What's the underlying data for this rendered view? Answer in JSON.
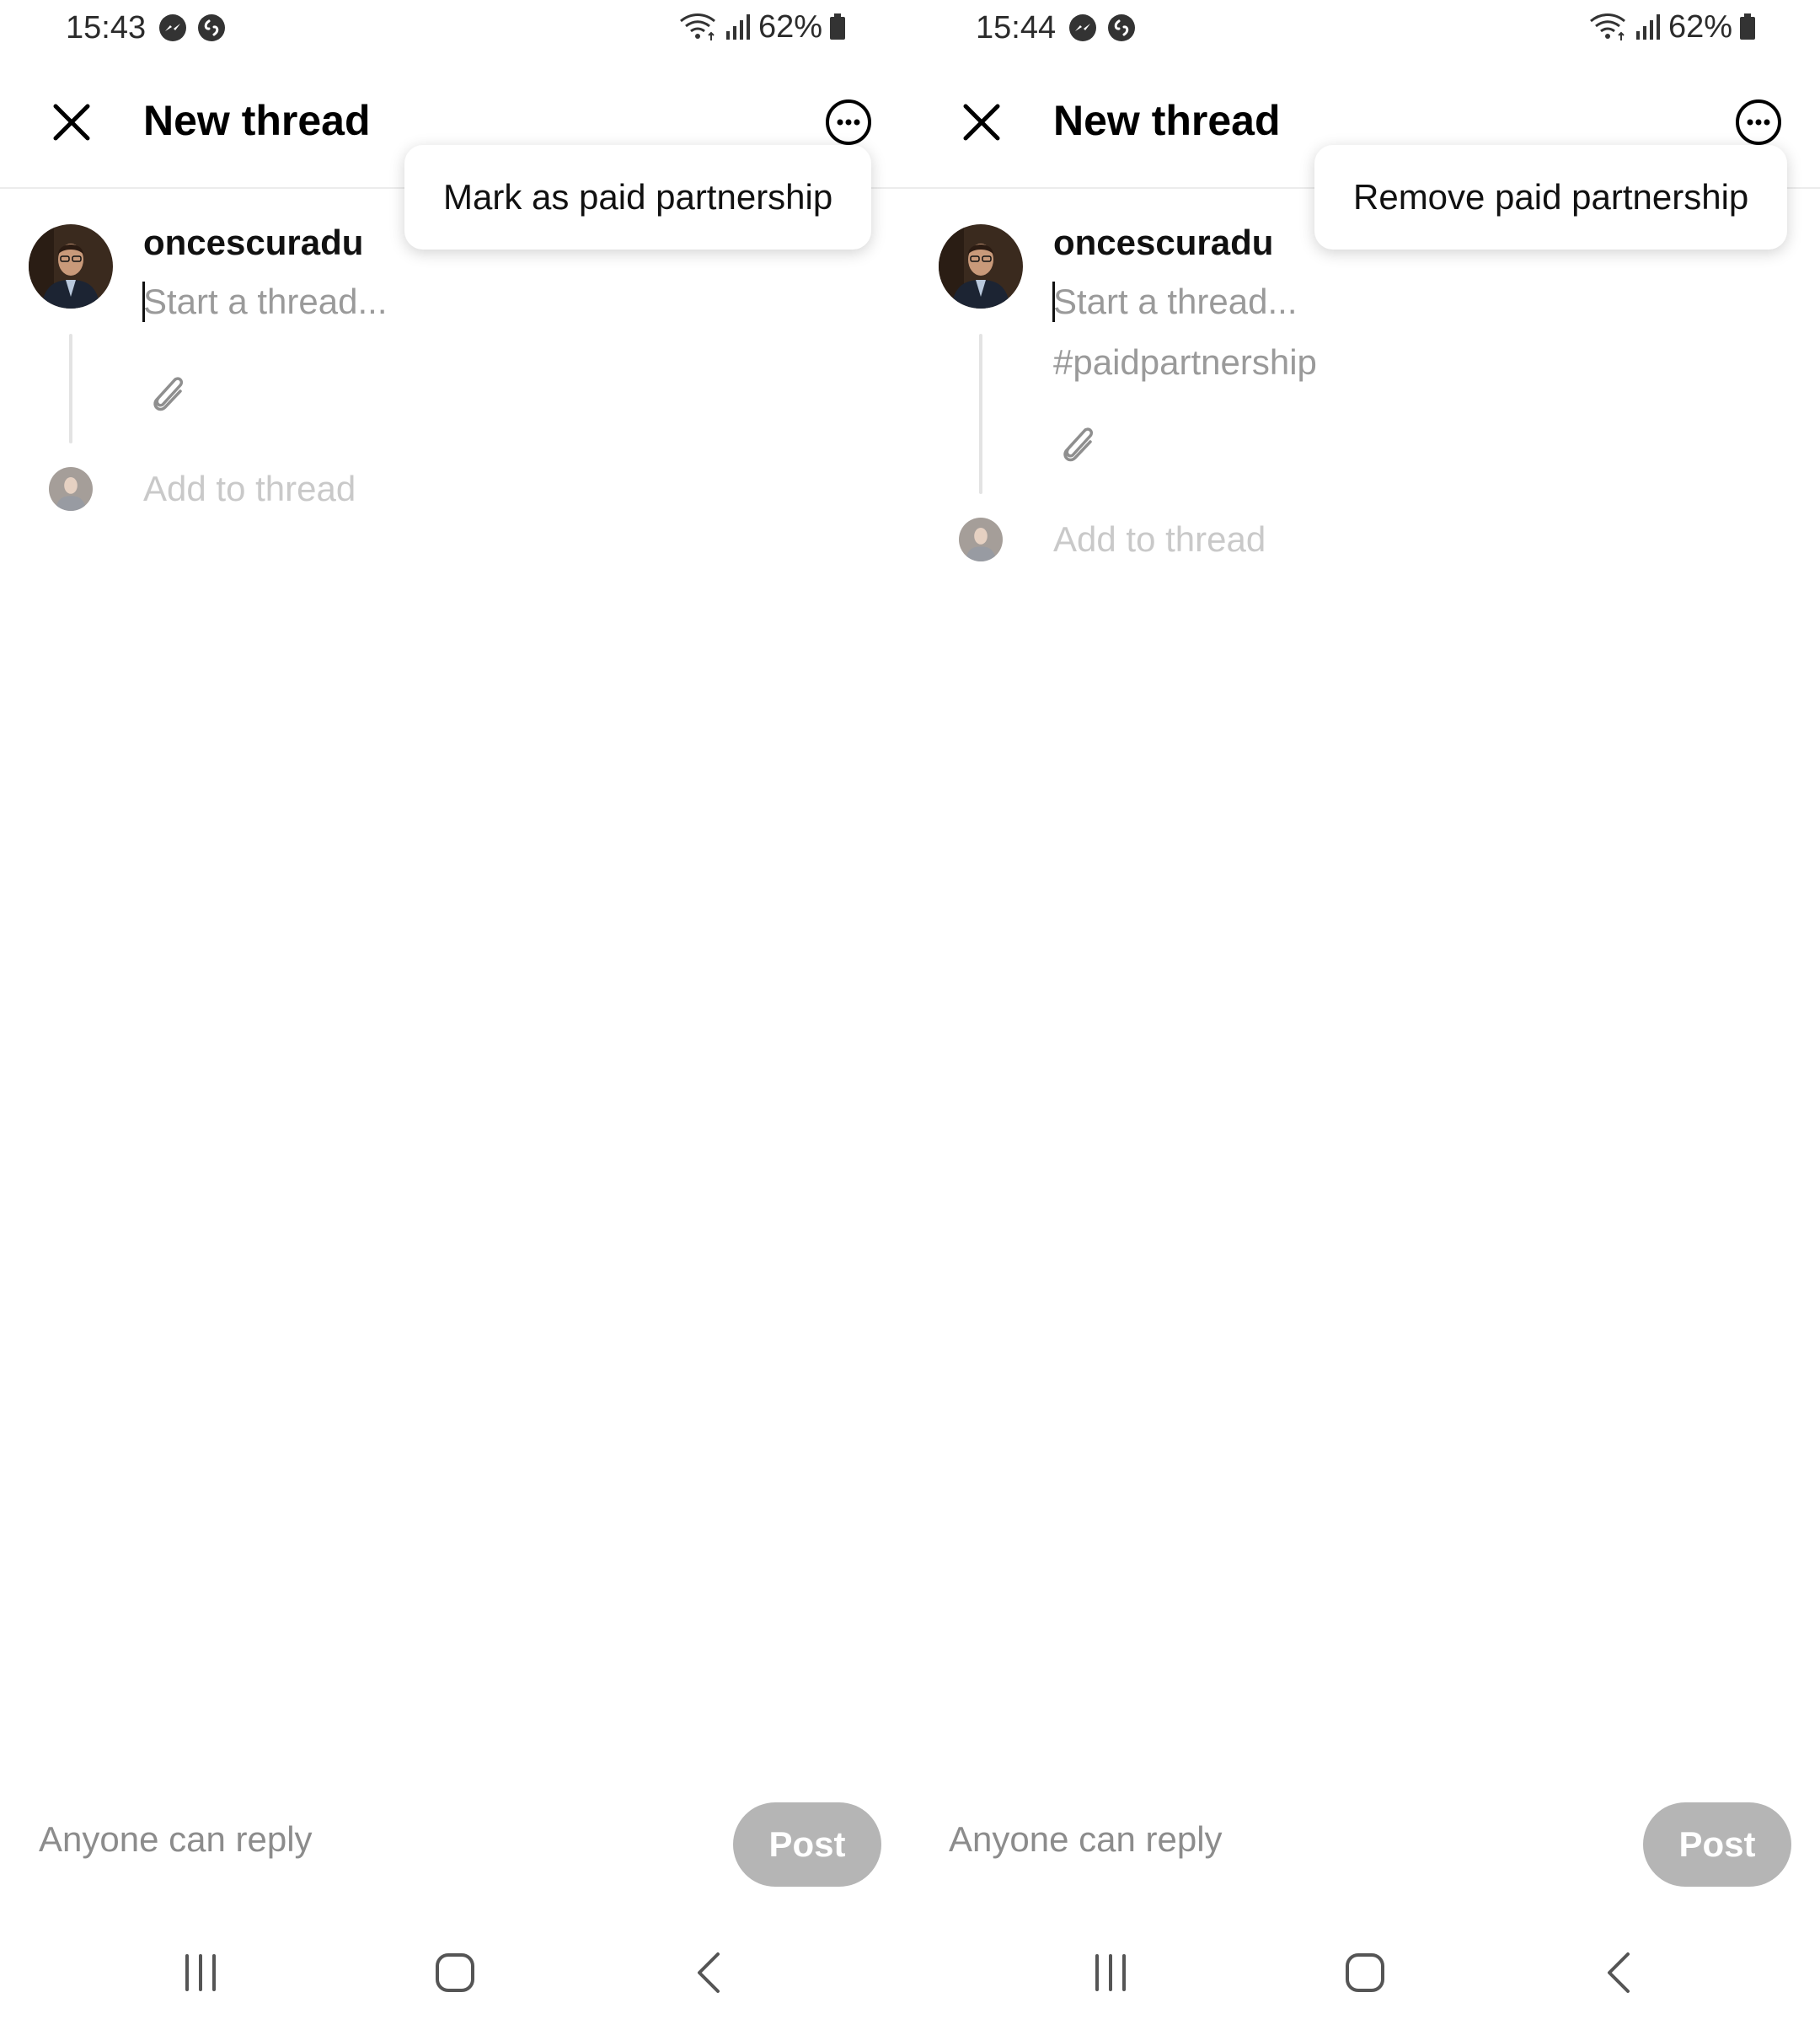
{
  "screens": [
    {
      "status": {
        "time": "15:43",
        "battery": "62%"
      },
      "header": {
        "title": "New thread"
      },
      "menu": {
        "option": "Mark as paid partnership"
      },
      "compose": {
        "username": "oncescuradu",
        "placeholder": "Start a thread...",
        "hashtag": "",
        "add_to_thread": "Add to thread"
      },
      "footer": {
        "reply_setting": "Anyone can reply",
        "post_label": "Post"
      }
    },
    {
      "status": {
        "time": "15:44",
        "battery": "62%"
      },
      "header": {
        "title": "New thread"
      },
      "menu": {
        "option": "Remove paid partnership"
      },
      "compose": {
        "username": "oncescuradu",
        "placeholder": "Start a thread...",
        "hashtag": "#paidpartnership",
        "add_to_thread": "Add to thread"
      },
      "footer": {
        "reply_setting": "Anyone can reply",
        "post_label": "Post"
      }
    }
  ],
  "colors": {
    "post_button_disabled": "#b5b5b5",
    "placeholder": "#9a9a9a",
    "muted_text": "#c9c9c9",
    "divider": "#ececec"
  },
  "icons": [
    "messenger-icon",
    "shazam-icon",
    "wifi-icon",
    "signal-icon",
    "battery-icon",
    "close-icon",
    "more-options-icon",
    "paperclip-icon",
    "recents-icon",
    "home-icon",
    "back-icon"
  ]
}
